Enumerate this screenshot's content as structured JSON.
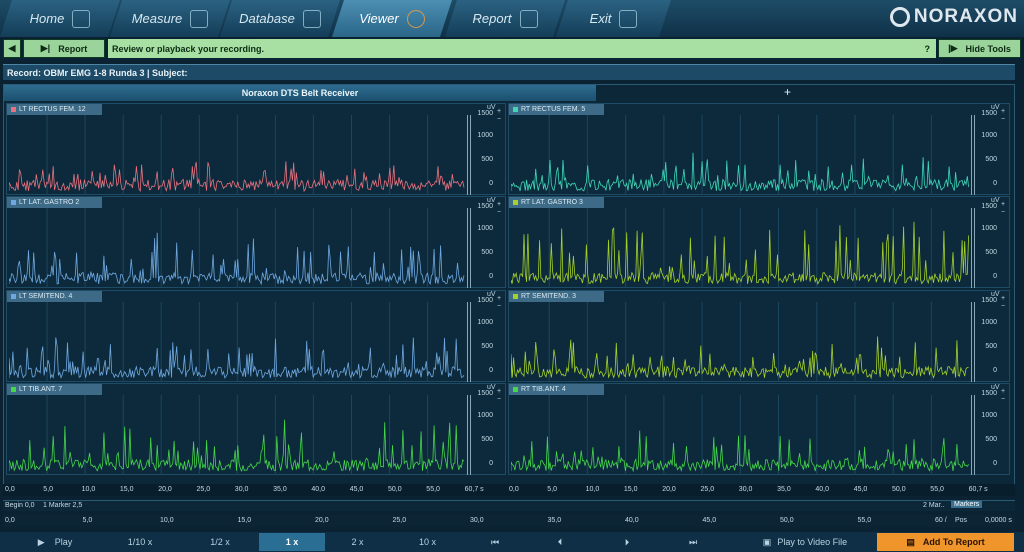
{
  "nav": {
    "tabs": [
      {
        "label": "Home",
        "icon": "home-icon"
      },
      {
        "label": "Measure",
        "icon": "measure-icon"
      },
      {
        "label": "Database",
        "icon": "database-icon"
      },
      {
        "label": "Viewer",
        "icon": "viewer-icon"
      },
      {
        "label": "Report",
        "icon": "report-icon"
      },
      {
        "label": "Exit",
        "icon": "exit-icon"
      }
    ],
    "active": "Viewer",
    "brand": "NORAXON"
  },
  "toolbar": {
    "report_label": "Report",
    "message": "Review or playback your recording.",
    "help": "?",
    "hide_tools": "Hide Tools"
  },
  "record": {
    "title": "Record: OBMr EMG 1-8 Runda 3 | Subject:"
  },
  "receiver": {
    "label": "Noraxon DTS Belt Receiver",
    "add": "+"
  },
  "units": "uV",
  "yticks": [
    "1500",
    "1000",
    "500",
    "0"
  ],
  "channels": [
    {
      "label": "LT RECTUS FEM.  12",
      "color": "#e8727f"
    },
    {
      "label": "RT RECTUS FEM.  5",
      "color": "#3fd7b8"
    },
    {
      "label": "LT LAT. GASTRO  2",
      "color": "#6fa8e0"
    },
    {
      "label": "RT LAT. GASTRO  3",
      "color": "#a6d12a"
    },
    {
      "label": "LT SEMITEND.  4",
      "color": "#6fa8e0"
    },
    {
      "label": "RT SEMITEND.  3",
      "color": "#a6d12a"
    },
    {
      "label": "LT TIB.ANT.  7",
      "color": "#46d64a"
    },
    {
      "label": "RT TIB.ANT.  4",
      "color": "#46d64a"
    }
  ],
  "time_axis_left": [
    "0,0",
    "5,0",
    "10,0",
    "15,0",
    "20,0",
    "25,0",
    "30,0",
    "35,0",
    "40,0",
    "45,0",
    "50,0",
    "55,0",
    "60,7 s"
  ],
  "time_axis_right": [
    "0,0",
    "5,0",
    "10,0",
    "15,0",
    "20,0",
    "25,0",
    "30,0",
    "35,0",
    "40,0",
    "45,0",
    "50,0",
    "55,0",
    "60,7 s"
  ],
  "markers": {
    "begin": "Begin 0,0",
    "m1": "1 Marker 2,5",
    "m2": "2 Mar..",
    "label": "Markers"
  },
  "timeline": {
    "ticks": [
      "0,0",
      "5,0",
      "10,0",
      "15,0",
      "20,0",
      "25,0",
      "30,0",
      "35,0",
      "40,0",
      "45,0",
      "50,0",
      "55,0",
      "60 /"
    ],
    "pos_label": "Pos",
    "pos_value": "0,0000 s"
  },
  "playback": {
    "play": "Play",
    "speeds": [
      "1/10 x",
      "1/2 x",
      "1 x",
      "2 x",
      "10 x"
    ],
    "selected_speed": "1 x",
    "video": "Play to Video File",
    "add": "Add To Report"
  }
}
